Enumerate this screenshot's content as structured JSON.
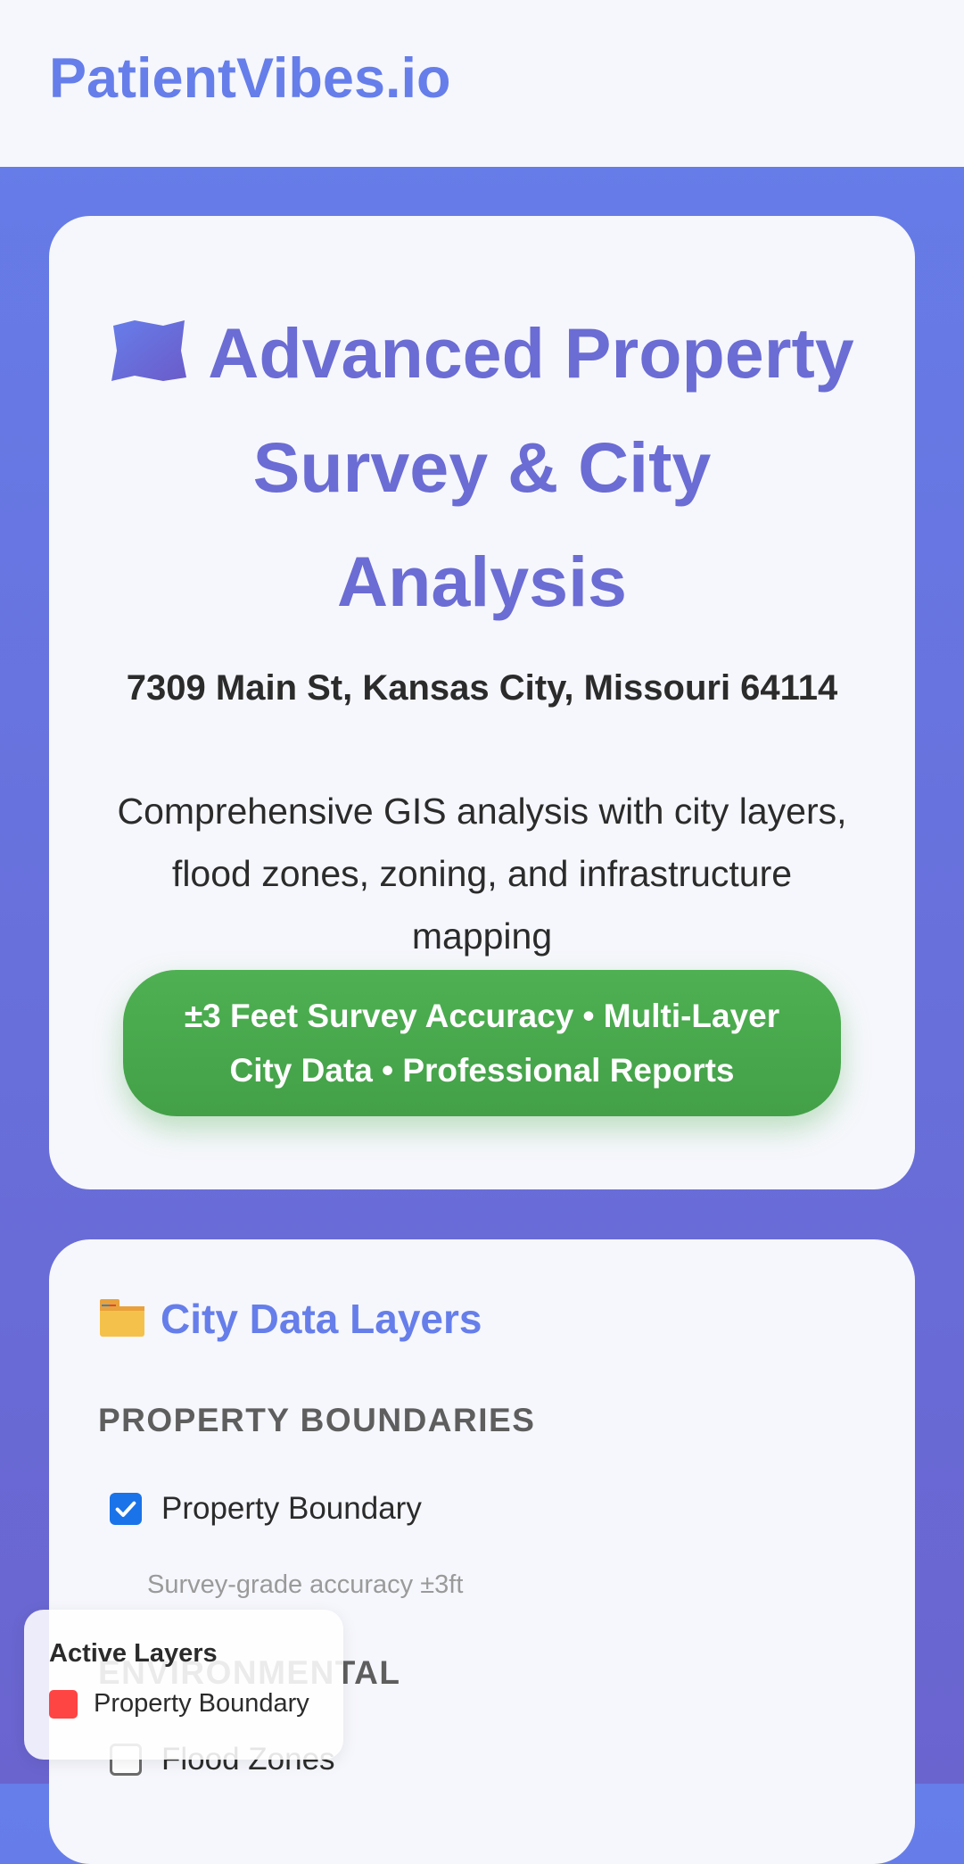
{
  "brand": "PatientVibes.io",
  "hero": {
    "icon": "map-icon",
    "title": "Advanced Property Survey & City Analysis",
    "address": "7309 Main St, Kansas City, Missouri 64114",
    "description": "Comprehensive GIS analysis with city layers, flood zones, zoning, and infrastructure mapping",
    "badge": "±3 Feet Survey Accuracy • Multi-Layer City Data • Professional Reports"
  },
  "layers": {
    "icon": "folder-icon",
    "heading": "City Data Layers",
    "groups": [
      {
        "title": "PROPERTY BOUNDARIES",
        "items": [
          {
            "label": "Property Boundary",
            "checked": true,
            "note": "Survey-grade accuracy ±3ft"
          }
        ]
      },
      {
        "title": "ENVIRONMENTAL",
        "items": [
          {
            "label": "Flood Zones",
            "checked": false
          }
        ]
      }
    ]
  },
  "legend": {
    "title": "Active Layers",
    "items": [
      {
        "label": "Property Boundary",
        "color": "#ff4444"
      }
    ]
  }
}
